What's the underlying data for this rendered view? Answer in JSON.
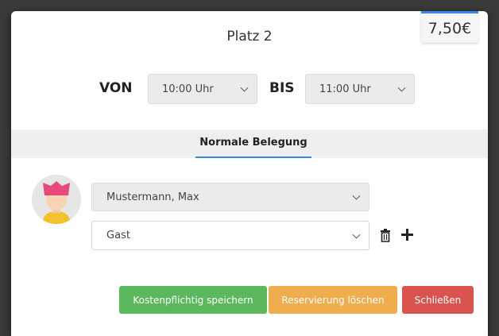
{
  "modal": {
    "price": "7,50€",
    "title": "Platz 2",
    "von_label": "VON",
    "bis_label": "BIS",
    "von_value": "10:00 Uhr",
    "bis_value": "11:00 Uhr",
    "tab_label": "Normale Belegung",
    "member_value": "Mustermann, Max",
    "guest_value": "Gast",
    "buttons": {
      "save": "Kostenpflichtig speichern",
      "delete": "Reservierung löschen",
      "close": "Schließen"
    }
  },
  "colors": {
    "accent": "#3a86ee",
    "save": "#5cb85c",
    "delete": "#f0ad4e",
    "close": "#d9534f"
  }
}
